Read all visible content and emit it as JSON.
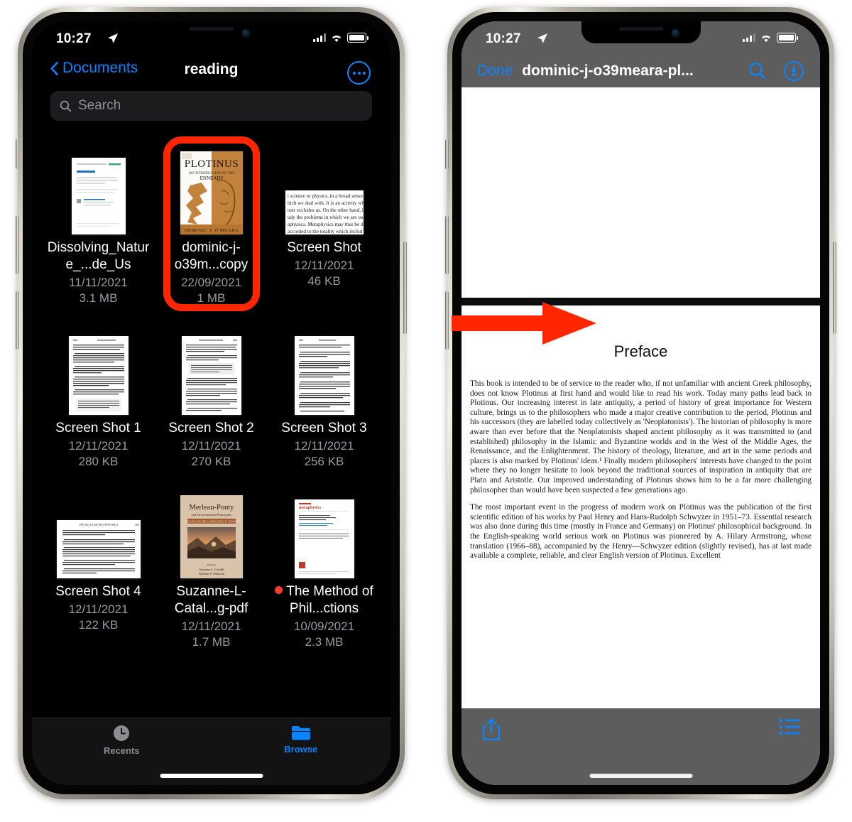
{
  "colors": {
    "accent_blue": "#0a84ff",
    "annotation_red": "#ff2600",
    "unread_dot": "#ff3b30",
    "dark_bg": "#000000",
    "pdf_chrome_gray": "#5d5d5d"
  },
  "left_phone": {
    "status_bar": {
      "time": "10:27",
      "location_icon": "location-arrow-icon",
      "cellular_icon": "signal-bars-icon",
      "wifi_icon": "wifi-icon",
      "battery_icon": "battery-icon"
    },
    "nav": {
      "back_label": "Documents",
      "back_icon": "chevron-left-icon",
      "title": "reading",
      "more_icon": "ellipsis-circle-icon"
    },
    "search": {
      "placeholder": "Search",
      "icon": "search-icon"
    },
    "files": [
      {
        "name": "Dissolving_Nature_...de_Us",
        "date": "11/11/2021",
        "size": "3.1 MB",
        "thumb": "document-preview",
        "highlighted": false,
        "unread": false
      },
      {
        "name": "dominic-j-o39m...copy",
        "date": "22/09/2021",
        "size": "1 MB",
        "thumb": "plotinus-book-cover",
        "highlighted": true,
        "unread": false
      },
      {
        "name": "Screen Shot",
        "date": "12/11/2021",
        "size": "46 KB",
        "thumb": "text-crop-screenshot",
        "highlighted": false,
        "unread": false
      },
      {
        "name": "Screen Shot 1",
        "date": "12/11/2021",
        "size": "280 KB",
        "thumb": "book-page-screenshot",
        "highlighted": false,
        "unread": false
      },
      {
        "name": "Screen Shot 2",
        "date": "12/11/2021",
        "size": "270 KB",
        "thumb": "book-page-screenshot",
        "highlighted": false,
        "unread": false
      },
      {
        "name": "Screen Shot 3",
        "date": "12/11/2021",
        "size": "256 KB",
        "thumb": "book-page-screenshot",
        "highlighted": false,
        "unread": false
      },
      {
        "name": "Screen Shot 4",
        "date": "12/11/2021",
        "size": "122 KB",
        "thumb": "physics-metaphysics-page",
        "highlighted": false,
        "unread": false
      },
      {
        "name": "Suzanne-L-Catal...g-pdf",
        "date": "12/11/2021",
        "size": "1.7 MB",
        "thumb": "merleau-ponty-book-cover",
        "highlighted": false,
        "unread": false
      },
      {
        "name": "The Method of Phil...ctions",
        "date": "10/09/2021",
        "size": "2.3 MB",
        "thumb": "journal-article-page",
        "highlighted": false,
        "unread": true
      }
    ],
    "tab_bar": [
      {
        "label": "Recents",
        "icon": "clock-icon",
        "active": false
      },
      {
        "label": "Browse",
        "icon": "folder-icon",
        "active": true
      }
    ]
  },
  "right_phone": {
    "status_bar": {
      "time": "10:27",
      "location_icon": "location-arrow-icon",
      "cellular_icon": "signal-bars-icon",
      "wifi_icon": "wifi-icon",
      "battery_icon": "battery-icon"
    },
    "nav": {
      "done_label": "Done",
      "title": "dominic-j-o39meara-pl...",
      "search_icon": "search-icon",
      "markup_icon": "markup-pen-circle-icon"
    },
    "document": {
      "heading": "Preface",
      "paragraphs": [
        "This book is intended to be of service to the reader who, if not unfamiliar with ancient Greek philosophy, does not know Plotinus at first hand and would like to read his work. Today many paths lead back to Plotinus. Our increasing interest in late antiquity, a period of history of great importance for Western culture, brings us to the philosophers who made a major creative contribution to the period, Plotinus and his successors (they are labelled today collectively as 'Neoplatonists'). The historian of philosophy is more aware than ever before that the Neoplatonists shaped ancient philosophy as it was transmitted to (and established) philosophy in the Islamic and Byzantine worlds and in the West of the Middle Ages, the Renaissance, and the Enlightenment. The history of theology, literature, and art in the same periods and places is also marked by Plotinus' ideas.¹ Finally modern philosophers' interests have changed to the point where they no longer hesitate to look beyond the traditional sources of inspiration in antiquity that are Plato and Aristotle. Our improved understanding of Plotinus shows him to be a far more challenging philosopher than would have been suspected a few generations ago.",
        "The most important event in the progress of modern work on Plotinus was the publication of the first scientific edition of his works by Paul Henry and Hans-Rudolph Schwyzer in 1951–73. Essential research was also done during this time (mostly in France and Germany) on Plotinus' philosophical background. In the English-speaking world serious work on Plotinus was pioneered by A. Hilary Armstrong, whose translation (1966–88), accompanied by the Henry—Schwyzer edition (slightly revised), has at last made available a complete, reliable, and clear English version of Plotinus. Excellent"
      ]
    },
    "toolbar": {
      "share_icon": "share-icon",
      "list_icon": "table-of-contents-icon"
    }
  },
  "annotations": {
    "highlight_rectangle": {
      "target": "dominic-j-o39m...copy",
      "color": "#ff2600"
    },
    "arrow": {
      "direction": "right",
      "color": "#ff2600"
    }
  }
}
